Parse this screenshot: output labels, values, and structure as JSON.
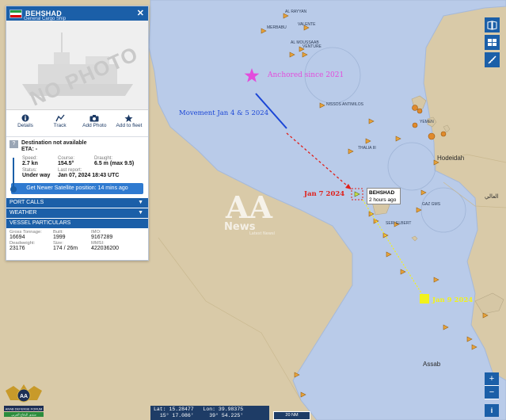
{
  "vessel": {
    "name": "BEHSHAD",
    "type": "General Cargo Ship",
    "flag_colors": [
      "#239f40",
      "#ffffff",
      "#da0000"
    ],
    "photo_text": "NO PHOTO",
    "destination_label": "Destination not available",
    "eta_label": "ETA: -",
    "q_mark": "?"
  },
  "actions": [
    {
      "label": "Details",
      "icon": "info-icon"
    },
    {
      "label": "Track",
      "icon": "track-icon"
    },
    {
      "label": "Add Photo",
      "icon": "camera-icon"
    },
    {
      "label": "Add to fleet",
      "icon": "star-icon"
    }
  ],
  "stats": {
    "speed_label": "Speed:",
    "speed": "2.7 kn",
    "course_label": "Course:",
    "course": "154.5°",
    "draught_label": "Draught:",
    "draught": "6.5 m (max 9.5)",
    "status_label": "Status:",
    "status": "Under way",
    "report_label": "Last report:",
    "report": "Jan 07, 2024 18:43 UTC"
  },
  "sat_button": "Get Newer Satellite position: 14 mins ago",
  "sections": {
    "port_calls": "PORT CALLS",
    "weather": "WEATHER",
    "particulars": "VESSEL PARTICULARS"
  },
  "particulars": {
    "gt_label": "Gross Tonnage:",
    "gt": "16694",
    "built_label": "Built:",
    "built": "1999",
    "imo_label": "IMO:",
    "imo": "9167289",
    "dwt_label": "Deadweight:",
    "dwt": "23176",
    "size_label": "Size:",
    "size": "174 / 26m",
    "mmsi_label": "MMSI:",
    "mmsi": "422036200"
  },
  "annotations": {
    "anchored": "Anchored since 2021",
    "movement": "Movement Jan 4 & 5 2024",
    "jan7": "Jan 7 2024",
    "jan9": "Jan 9 2024",
    "tooltip_name": "BEHSHAD",
    "tooltip_time": "2 hours ago"
  },
  "place_labels": {
    "al_rayyan": "AL RAYYAN",
    "valente": "VALENTE",
    "merbabu": "MERBABU",
    "al_moussaab": "AL MOUSSAAB",
    "venture": "VENTURE",
    "nissos": "NISSOS ANTIMILOS",
    "thalia": "THALIA III",
    "yemen": "YEMEN",
    "hodeidah": "Hodeidah",
    "gaz_gms": "GAZ GMS",
    "seri_elbert": "SERI ELBERT",
    "assab": "Assab",
    "arabic": "العالي"
  },
  "watermark": {
    "big": "AA",
    "news": "News",
    "sub": "Latest Newsl"
  },
  "coords": {
    "lat": "Lat: 15.28477",
    "lon": "Lon: 39.98375",
    "lat_dms": "15° 17.086'",
    "lon_dms": "39° 54.225'",
    "scale": "20 NM"
  },
  "zoom": {
    "plus": "+",
    "minus": "−",
    "info": "i"
  },
  "logo_text": {
    "top": "AA",
    "bottom": "ARAB DEFENSE FORUM",
    "arabic": "منتدى الدفاع العربي"
  },
  "colors": {
    "sea": "#b9cbe9",
    "land": "#d9caa8",
    "panel_blue": "#1b5fa8",
    "magenta": "#e34ddc",
    "movement_blue": "#1b46d6",
    "red": "#e0201a",
    "highlight": "#f2f21b"
  }
}
